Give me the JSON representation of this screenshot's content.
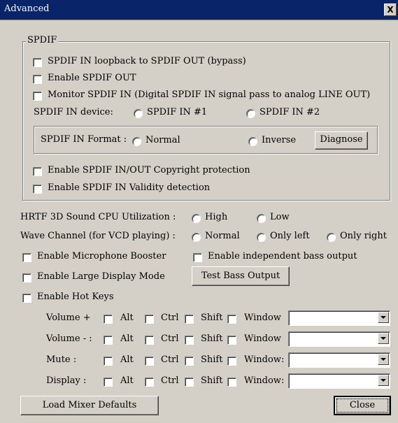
{
  "window": {
    "title": "Advanced",
    "close_glyph": "X"
  },
  "spdif": {
    "group_label": "SPDIF",
    "loopback": "SPDIF IN loopback to SPDIF OUT (bypass)",
    "enable_out": "Enable SPDIF OUT",
    "monitor": "Monitor SPDIF IN  (Digital SPDIF IN signal pass to analog LINE OUT)",
    "device_label": "SPDIF IN device:",
    "device_1": "SPDIF IN #1",
    "device_2": "SPDIF IN #2",
    "format_label": "SPDIF IN Format :",
    "format_normal": "Normal",
    "format_inverse": "Inverse",
    "diagnose": "Diagnose",
    "copyright": "Enable SPDIF IN/OUT Copyright protection",
    "validity": "Enable SPDIF IN Validity detection"
  },
  "hrtf": {
    "label": "HRTF 3D Sound CPU Utilization :",
    "high": "High",
    "low": "Low"
  },
  "wave": {
    "label": "Wave Channel (for VCD playing) :",
    "normal": "Normal",
    "only_left": "Only left",
    "only_right": "Only right"
  },
  "options": {
    "mic_booster": "Enable Microphone Booster",
    "independent_bass": "Enable independent bass output",
    "large_display": "Enable Large Display Mode",
    "test_bass": "Test Bass Output",
    "hot_keys": "Enable Hot Keys"
  },
  "hotkeys": [
    {
      "label": "Volume +",
      "alt": "Alt",
      "ctrl": "Ctrl",
      "shift": "Shift",
      "window": "Window",
      "value": ""
    },
    {
      "label": "Volume - :",
      "alt": "Alt",
      "ctrl": "Ctrl",
      "shift": "Shift",
      "window": "Window",
      "value": ""
    },
    {
      "label": "Mute :",
      "alt": "Alt",
      "ctrl": "Ctrl",
      "shift": "Shift",
      "window": "Window:",
      "value": ""
    },
    {
      "label": "Display :",
      "alt": "Alt",
      "ctrl": "Ctrl",
      "shift": "Shift",
      "window": "Window:",
      "value": ""
    }
  ],
  "footer": {
    "load_defaults": "Load Mixer Defaults",
    "close": "Close"
  }
}
